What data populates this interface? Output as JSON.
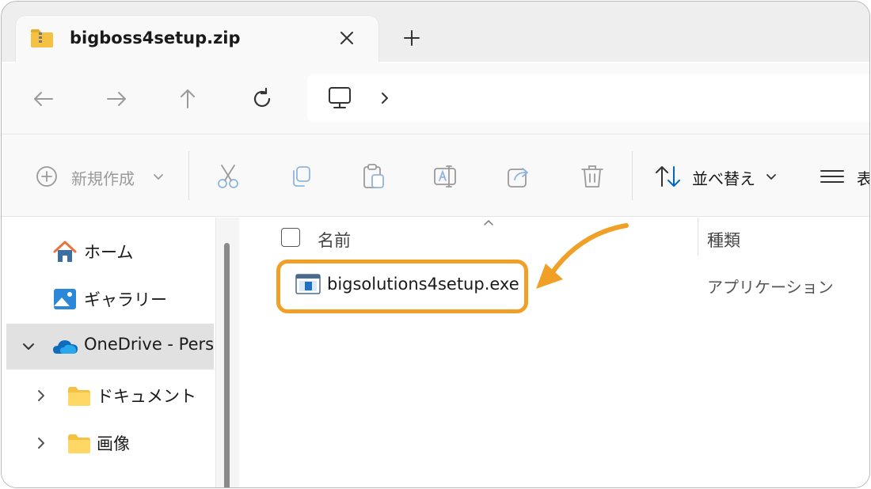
{
  "tab": {
    "title": "bigboss4setup.zip",
    "close_icon": "close-icon",
    "new_tab_icon": "plus-icon"
  },
  "nav": {
    "back_icon": "arrow-left-icon",
    "forward_icon": "arrow-right-icon",
    "up_icon": "arrow-up-icon",
    "refresh_icon": "refresh-icon",
    "location_icon": "monitor-icon",
    "separator": "›"
  },
  "command_bar": {
    "new_label": "新規作成",
    "sort_label": "並べ替え",
    "view_label": "表",
    "icons": [
      "cut-icon",
      "copy-icon",
      "paste-icon",
      "rename-icon",
      "share-icon",
      "delete-icon"
    ]
  },
  "sidebar": {
    "items": [
      {
        "label": "ホーム",
        "icon": "home-icon"
      },
      {
        "label": "ギャラリー",
        "icon": "gallery-icon"
      },
      {
        "label": "OneDrive - Perso",
        "icon": "onedrive-cloud-icon"
      },
      {
        "label": "ドキュメント",
        "icon": "folder-icon"
      },
      {
        "label": "画像",
        "icon": "folder-icon"
      }
    ]
  },
  "columns": {
    "name": "名前",
    "type": "種類"
  },
  "files": [
    {
      "name": "bigsolutions4setup.exe",
      "type": "アプリケーション",
      "icon": "application-icon"
    }
  ],
  "colors": {
    "highlight": "#f0a026",
    "accent": "#0067c0",
    "folder": "#f5c142"
  }
}
